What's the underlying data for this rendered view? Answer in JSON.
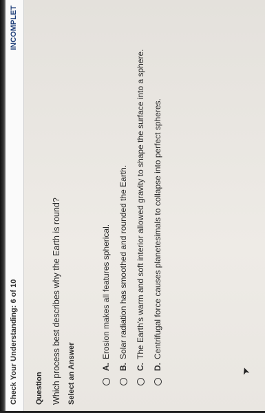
{
  "header": {
    "title": "Check Your Understanding: 6 of 10",
    "status": "INCOMPLET"
  },
  "question": {
    "label": "Question",
    "text": "Which process best describes why the Earth is round?"
  },
  "answers": {
    "label": "Select an Answer",
    "options": [
      {
        "letter": "A.",
        "text": "Erosion makes all features spherical."
      },
      {
        "letter": "B.",
        "text": "Solar radiation has smoothed and rounded the Earth."
      },
      {
        "letter": "C.",
        "text": "The Earth's warm and soft interior allowed gravity to shape the surface into a sphere."
      },
      {
        "letter": "D.",
        "text": "Centrifugal force causes planetesimals to collapse into perfect spheres."
      }
    ]
  },
  "colors": {
    "status": "#1f3f7a",
    "background": "#e9e6e1"
  }
}
